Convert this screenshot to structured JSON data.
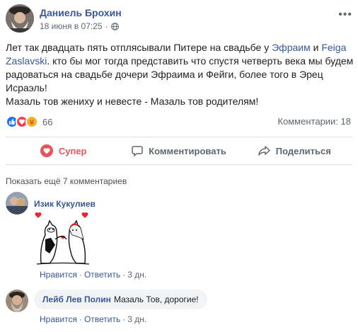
{
  "post": {
    "author": "Даниель Брохин",
    "timestamp": "18 июня в 07:25",
    "more_label": "•••",
    "text_part1": "Лет так двадцать пять отплясывали Питере на свадьбе у ",
    "tag1": "Эфраим",
    "text_and": " и ",
    "tag2": "Feiga Zaslavski",
    "text_part2": ". кто бы мог тогда представить что спустя четверть века мы будем радоваться на свадьбе дочери Эфраима и Фейги, более того в Эрец Исраэль!",
    "text_line2": "Мазаль тов жениху и невесте - Мазаль тов родителям!",
    "reactions_count": "66",
    "comments_count": "Комментарии: 18"
  },
  "actions": {
    "like_label": "Супер",
    "comment_label": "Комментировать",
    "share_label": "Поделиться"
  },
  "comments": {
    "show_more": "Показать ещё 7 комментариев",
    "items": [
      {
        "name": "Изик Кукулиев",
        "text": "",
        "like": "Нравится",
        "reply": "Ответить",
        "time": "3 дн."
      },
      {
        "name": "Лейб Лев Полин",
        "text": "Мазаль Тов, дорогие!",
        "like": "Нравится",
        "reply": "Ответить",
        "time": "3 дн."
      }
    ]
  },
  "colors": {
    "link": "#385898",
    "love": "#e9535b",
    "like": "#1877f2",
    "muted": "#606770"
  },
  "icons": [
    "globe-icon",
    "like-reaction-icon",
    "love-reaction-icon",
    "care-reaction-icon",
    "heart-icon",
    "comment-icon",
    "share-icon",
    "wedding-sticker"
  ]
}
